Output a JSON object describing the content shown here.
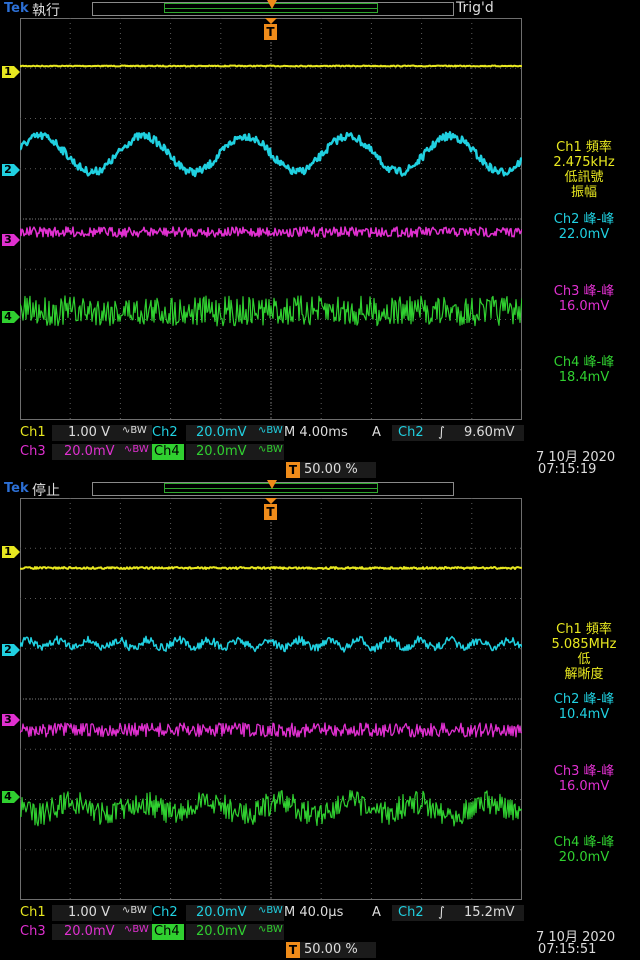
{
  "screens": [
    {
      "brand": "Tek",
      "state": "執行",
      "trig_status": "Trig'd",
      "channels": {
        "ch1": {
          "label": "Ch1",
          "scale": "1.00 V",
          "coupling": "∿BW"
        },
        "ch2": {
          "label": "Ch2",
          "scale": "20.0mV",
          "coupling": "∿BW"
        },
        "ch3": {
          "label": "Ch3",
          "scale": "20.0mV",
          "coupling": "∿BW"
        },
        "ch4": {
          "label": "Ch4",
          "scale": "20.0mV",
          "coupling": "∿BW"
        }
      },
      "timebase": "M 4.00ms",
      "trigger": {
        "mode": "A",
        "source": "Ch2",
        "slope": "∫",
        "level": "9.60mV"
      },
      "trigger_position": "50.00 %",
      "date": "7 10月 2020",
      "time": "07:15:19",
      "measurements": {
        "m1": {
          "title": "Ch1 頻率",
          "value": "2.475kHz",
          "note1": "低訊號",
          "note2": "振幅"
        },
        "m2": {
          "title": "Ch2 峰-峰",
          "value": "22.0mV"
        },
        "m3": {
          "title": "Ch3 峰-峰",
          "value": "16.0mV"
        },
        "m4": {
          "title": "Ch4 峰-峰",
          "value": "18.4mV"
        }
      },
      "channel_markers": [
        "1",
        "2",
        "3",
        "4"
      ]
    },
    {
      "brand": "Tek",
      "state": "停止",
      "trig_status": "",
      "channels": {
        "ch1": {
          "label": "Ch1",
          "scale": "1.00 V",
          "coupling": "∿BW"
        },
        "ch2": {
          "label": "Ch2",
          "scale": "20.0mV",
          "coupling": "∿BW"
        },
        "ch3": {
          "label": "Ch3",
          "scale": "20.0mV",
          "coupling": "∿BW"
        },
        "ch4": {
          "label": "Ch4",
          "scale": "20.0mV",
          "coupling": "∿BW"
        }
      },
      "timebase": "M 40.0µs",
      "trigger": {
        "mode": "A",
        "source": "Ch2",
        "slope": "∫",
        "level": "15.2mV"
      },
      "trigger_position": "50.00 %",
      "date": "7 10月 2020",
      "time": "07:15:51",
      "measurements": {
        "m1": {
          "title": "Ch1 頻率",
          "value": "5.085MHz",
          "note1": "低",
          "note2": "解晰度"
        },
        "m2": {
          "title": "Ch2 峰-峰",
          "value": "10.4mV"
        },
        "m3": {
          "title": "Ch3 峰-峰",
          "value": "16.0mV"
        },
        "m4": {
          "title": "Ch4 峰-峰",
          "value": "20.0mV"
        }
      },
      "channel_markers": [
        "1",
        "2",
        "3",
        "4"
      ]
    }
  ],
  "colors": {
    "ch1": "#e8e820",
    "ch2": "#20d0e0",
    "ch3": "#e030d0",
    "ch4": "#30d030",
    "trigger": "#f08c1a",
    "brand": "#2c6fd4"
  },
  "trigger_marker": "T"
}
